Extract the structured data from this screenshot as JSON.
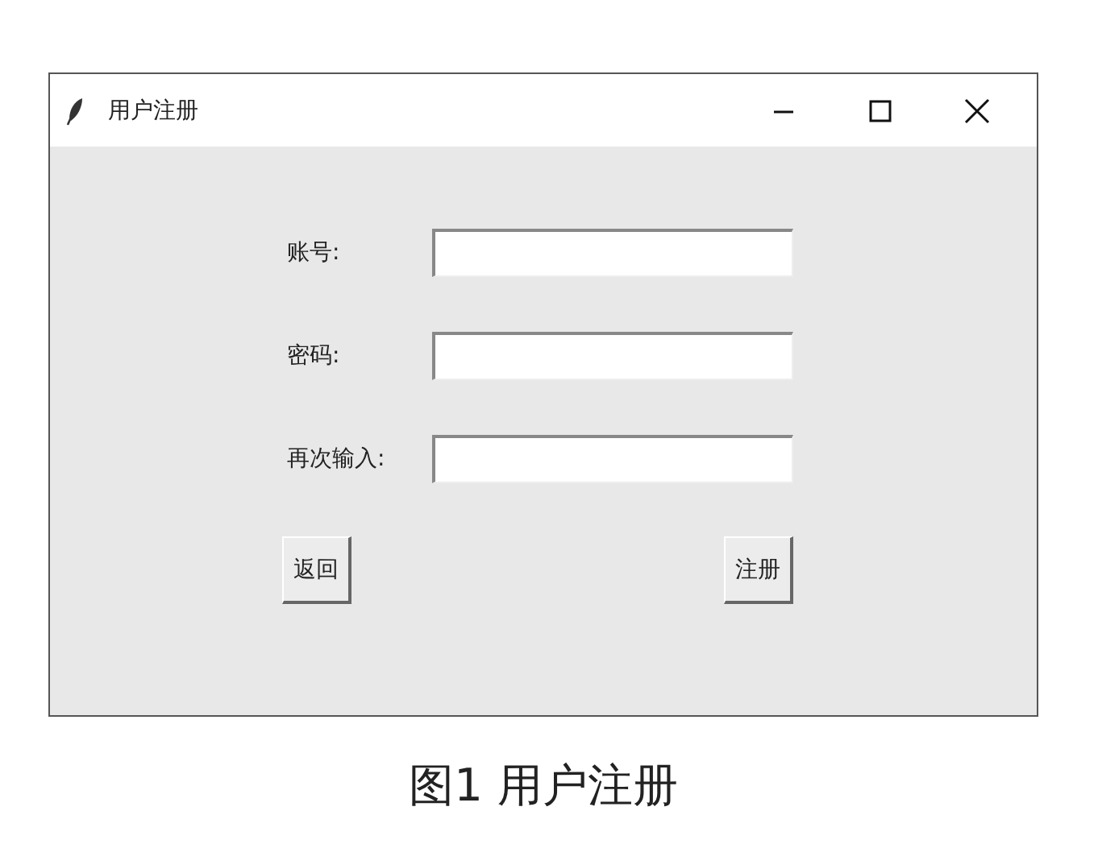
{
  "window": {
    "title": "用户注册"
  },
  "fields": [
    {
      "label": "账号:"
    },
    {
      "label": "密码:"
    },
    {
      "label": "再次输入:"
    }
  ],
  "buttons": [
    {
      "label": "返回"
    },
    {
      "label": "注册"
    }
  ],
  "caption": "图1 用户注册"
}
